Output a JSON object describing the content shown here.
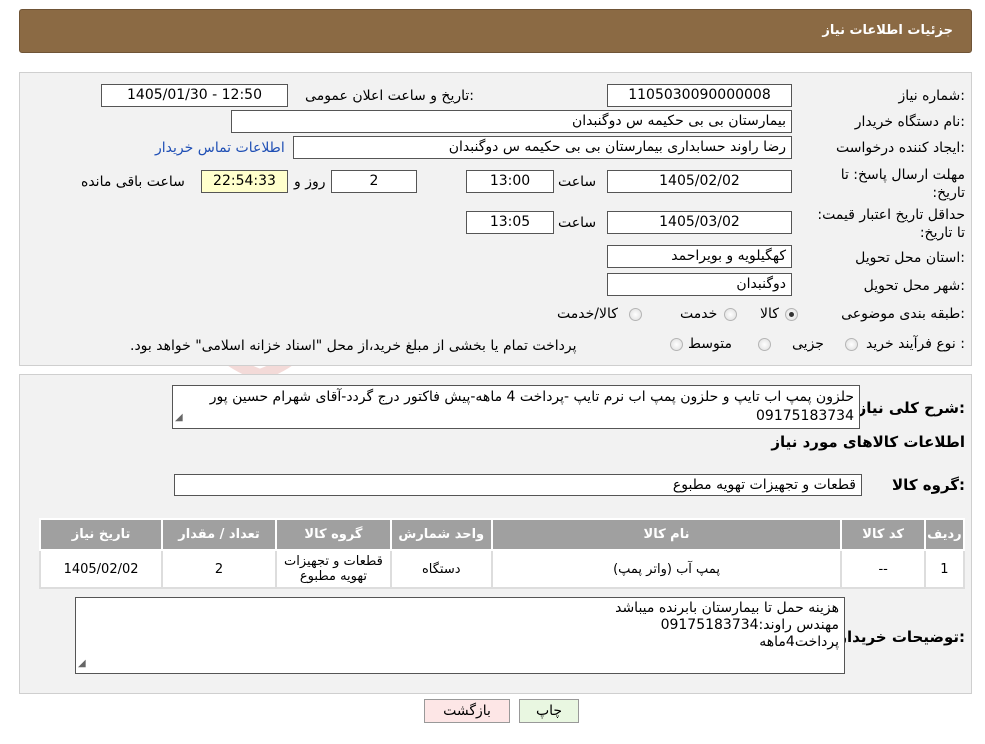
{
  "header": {
    "title": "جزئیات اطلاعات نیاز"
  },
  "form": {
    "need_number_label": "شماره نیاز:",
    "need_number": "1105030090000008",
    "announce_label": "تاریخ و ساعت اعلان عمومی:",
    "announce_value": "1405/01/30 - 12:50",
    "buyer_org_label": "نام دستگاه خریدار:",
    "buyer_org": "بیمارستان بی بی حکیمه س  دوگنبدان",
    "requester_label": "ایجاد کننده درخواست:",
    "requester": "رضا راوند حسابداری بیمارستان بی بی حکیمه س  دوگنبدان",
    "buyer_contact_link": "اطلاعات تماس خریدار",
    "deadline_label": "مهلت ارسال پاسخ: تا تاریخ:",
    "deadline_date": "1405/02/02",
    "time_label": "ساعت",
    "deadline_time": "13:00",
    "days_value": "2",
    "days_label": "روز و",
    "remaining_time": "22:54:33",
    "remaining_label": "ساعت باقی مانده",
    "validity_label": "حداقل تاریخ اعتبار قیمت: تا تاریخ:",
    "validity_date": "1405/03/02",
    "validity_time": "13:05",
    "province_label": "استان محل تحویل:",
    "province": "کهگیلویه و بویراحمد",
    "city_label": "شهر محل تحویل:",
    "city": "دوگنبدان",
    "category_label": "طبقه بندی موضوعی:",
    "category_options": [
      "کالا",
      "خدمت",
      "کالا/خدمت"
    ],
    "process_label": "نوع فرآیند خرید :",
    "process_options": [
      "جزیی",
      "متوسط"
    ],
    "process_note": "پرداخت تمام یا بخشی از مبلغ خرید،از محل \"اسناد خزانه اسلامی\" خواهد بود."
  },
  "summary": {
    "description_label": "شرح کلی نیاز:",
    "description": "حلزون پمپ اب تایپ و حلزون پمپ اب نرم تایپ -پرداخت 4 ماهه-پیش فاکتور درج گردد-آقای شهرام حسین پور 09175183734",
    "goods_info_title": "اطلاعات کالاهای مورد نیاز",
    "goods_group_label": "گروه کالا:",
    "goods_group": "قطعات و تجهیزات تهویه مطبوع"
  },
  "table": {
    "headers": [
      "ردیف",
      "کد کالا",
      "نام کالا",
      "واحد شمارش",
      "گروه کالا",
      "تعداد / مقدار",
      "تاریخ نیاز"
    ],
    "rows": [
      [
        "1",
        "--",
        "پمپ آب (واتر پمپ)",
        "دستگاه",
        "قطعات و تجهیزات تهویه مطبوع",
        "2",
        "1405/02/02"
      ]
    ]
  },
  "notes": {
    "label": "توضیحات خریدار:",
    "lines": [
      "هزینه حمل تا بیمارستان بابرنده میباشد",
      "مهندس راوند:09175183734",
      "پرداخت4ماهه"
    ]
  },
  "buttons": {
    "print": "چاپ",
    "back": "بازگشت"
  },
  "watermark": {
    "text": "AriaTender.neT"
  },
  "colors": {
    "header": "#8b6a44",
    "panel": "#f2f2f2",
    "link": "#1f4fb5",
    "yellow": "#ffffcc"
  }
}
